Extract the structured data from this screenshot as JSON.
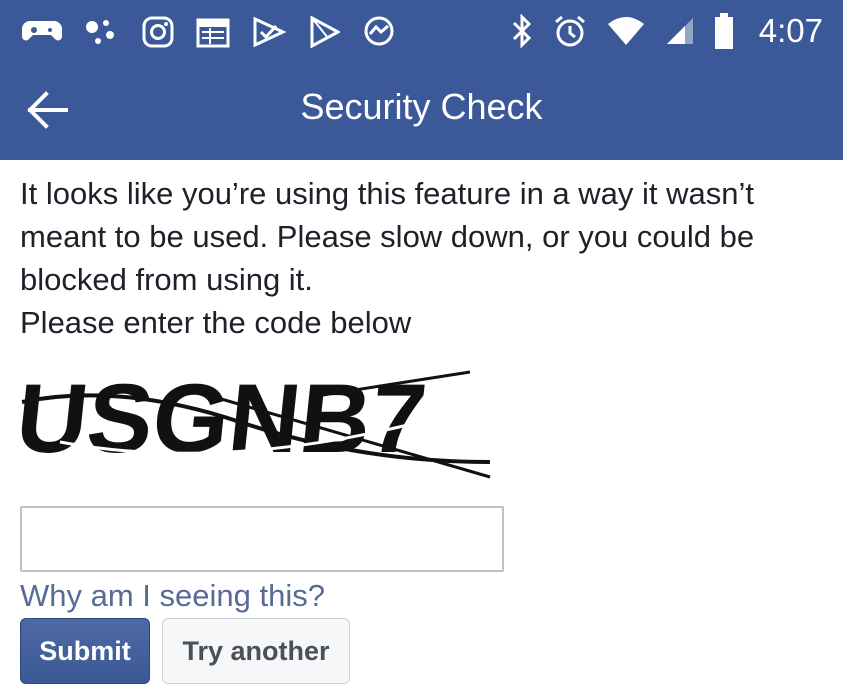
{
  "status_bar": {
    "time": "4:07",
    "left_icons": [
      "game-controller-icon",
      "dots-icon",
      "instagram-icon",
      "calendar-icon",
      "check-send-icon",
      "play-store-icon",
      "messenger-icon"
    ],
    "right_icons": [
      "bluetooth-icon",
      "alarm-icon",
      "wifi-icon",
      "signal-icon",
      "battery-icon"
    ]
  },
  "app_bar": {
    "title": "Security Check",
    "back_icon": "back-arrow-icon"
  },
  "main": {
    "message": "It looks like you’re using this feature in a way it wasn’t meant to be used. Please slow down, or you could be blocked from using it.",
    "prompt": "Please enter the code below",
    "captcha_text": "USGNB7",
    "code_input": {
      "value": "",
      "placeholder": ""
    },
    "why_link": "Why am I seeing this?",
    "submit_label": "Submit",
    "try_another_label": "Try another"
  },
  "colors": {
    "brand": "#3b5998",
    "link": "#576b95",
    "text": "#1d2129"
  }
}
